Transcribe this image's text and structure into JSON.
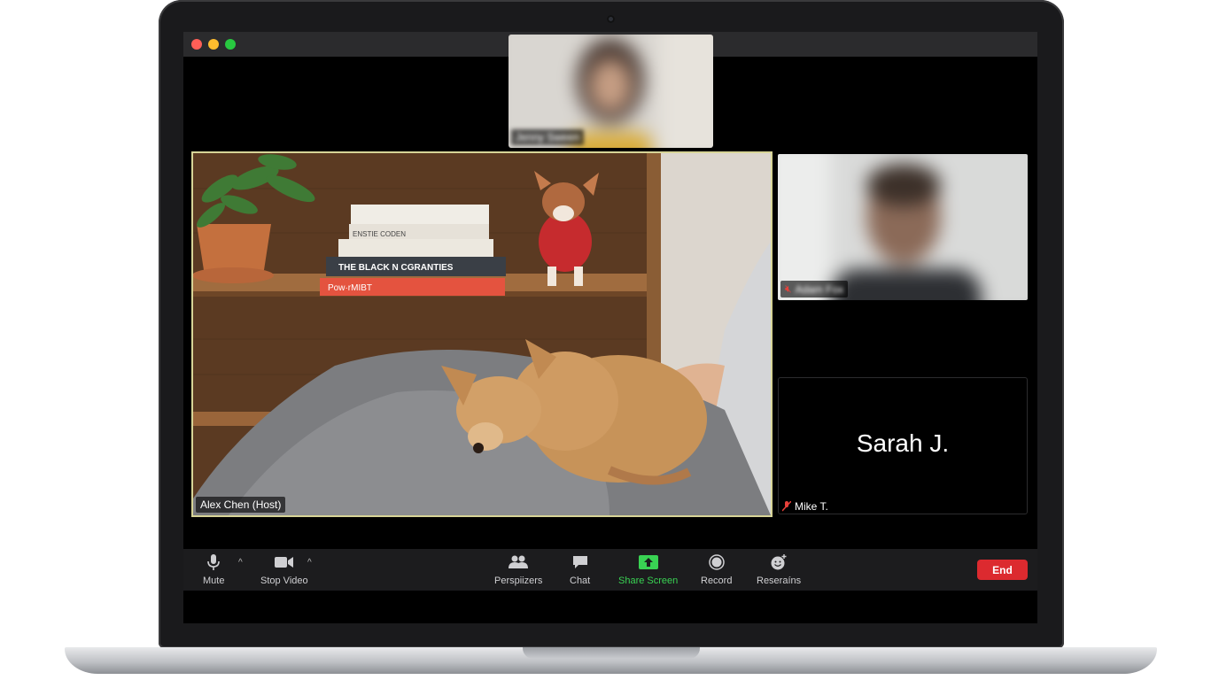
{
  "meeting": {
    "top_participant": {
      "name": "Jenny Sween"
    },
    "main_participant": {
      "name": "Alex Chen (Host)"
    },
    "right_participant": {
      "name": "Adam Fox"
    },
    "audio_tile": {
      "display_name": "Sarah J.",
      "label": "Mike T."
    }
  },
  "scene": {
    "books": [
      "Pow·rMIBT",
      "THE BLACK N CGRANTIES",
      "ENSTIE CODEN",
      ""
    ]
  },
  "toolbar": {
    "mute_label": "Mute",
    "video_label": "Stop Video",
    "participants_label": "Perspiizers",
    "chat_label": "Chat",
    "share_label": "Share Screen",
    "record_label": "Record",
    "reactions_label": "Reseraíns",
    "end_label": "End"
  },
  "colors": {
    "active_speaker_border": "#d7d497",
    "share_green": "#39d253",
    "end_red": "#dc2a2f",
    "mic_muted": "#e8413a"
  }
}
